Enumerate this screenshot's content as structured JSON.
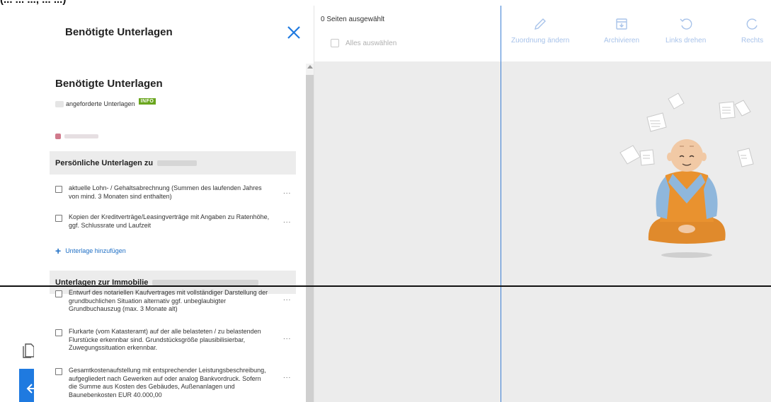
{
  "top_fragment": "(... ... ..., ... ...)",
  "panel": {
    "title": "Benötigte Unterlagen",
    "section_title": "Benötigte Unterlagen",
    "requested_label": "angeforderte Unterlagen",
    "info_badge": "INFO"
  },
  "groups": [
    {
      "title": "Persönliche Unterlagen zu",
      "items": [
        {
          "text": "aktuelle Lohn- / Gehaltsabrechnung (Summen des laufenden Jahres von mind. 3 Monaten sind enthalten)",
          "more": "..."
        },
        {
          "text": "Kopien der Kreditverträge/Leasingverträge mit Angaben zu Ratenhöhe, ggf. Schlussrate und Laufzeit",
          "more": "..."
        }
      ],
      "add_label": "Unterlage hinzufügen"
    },
    {
      "title": "Unterlagen zur Immobilie",
      "items": [
        {
          "text": "Entwurf des notariellen Kaufvertrages mit vollständiger Darstellung der grundbuchlichen Situation alternativ ggf. unbeglaubigter Grundbuchauszug (max. 3 Monate alt)",
          "more": "..."
        },
        {
          "text": "Flurkarte (vom Katasteramt) auf der alle belasteten / zu belastenden Flurstücke erkennbar sind. Grundstücksgröße plausibilisierbar, Zuwegungssituation erkennbar.",
          "more": "..."
        },
        {
          "text": "Gesamtkostenaufstellung mit entsprechender Leistungsbeschreibung, aufgegliedert nach Gewerken auf oder analog Bankvordruck. Sofern die Summe aus Kosten des Gebäudes, Außenanlagen und Baunebenkosten EUR 40.000,00",
          "more": "..."
        }
      ]
    }
  ],
  "pages": {
    "selected_count": "0 Seiten ausgewählt",
    "select_all": "Alles auswählen"
  },
  "toolbar": [
    {
      "label": "Zuordnung ändern",
      "icon": "pencil-icon"
    },
    {
      "label": "Archivieren",
      "icon": "archive-icon"
    },
    {
      "label": "Links drehen",
      "icon": "rotate-left-icon"
    },
    {
      "label": "Rechts",
      "icon": "rotate-right-icon"
    }
  ],
  "colors": {
    "accent": "#1f7ae0",
    "info_badge": "#6aa61e",
    "toolbar_disabled": "#a8c3ea",
    "group_bg": "#ececec"
  }
}
